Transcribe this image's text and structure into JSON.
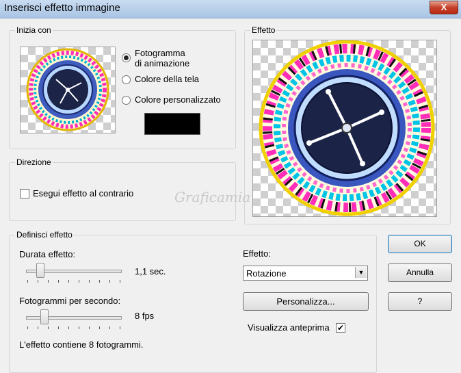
{
  "window": {
    "title": "Inserisci effetto immagine",
    "close_label": "X"
  },
  "start_with": {
    "legend": "Inizia con",
    "options": [
      {
        "line1": "Fotogramma",
        "line2": "di animazione",
        "selected": true
      },
      {
        "line1": "Colore della tela",
        "selected": false
      },
      {
        "line1": "Colore personalizzato",
        "selected": false
      }
    ],
    "custom_color": "#000000"
  },
  "direction": {
    "legend": "Direzione",
    "reverse_label": "Esegui effetto al contrario",
    "reverse_checked": false
  },
  "preview": {
    "legend": "Effetto"
  },
  "define": {
    "legend": "Definisci effetto",
    "duration_label": "Durata effetto:",
    "duration_value": "1,1 sec.",
    "fps_label": "Fotogrammi per secondo:",
    "fps_value": "8 fps",
    "info": "L'effetto contiene 8 fotogrammi.",
    "effect_label": "Effetto:",
    "effect_value": "Rotazione",
    "customize_label": "Personalizza...",
    "show_preview_label": "Visualizza anteprima",
    "show_preview_checked": true
  },
  "buttons": {
    "ok": "OK",
    "cancel": "Annulla",
    "help": "?"
  },
  "watermark": "Graficamia"
}
